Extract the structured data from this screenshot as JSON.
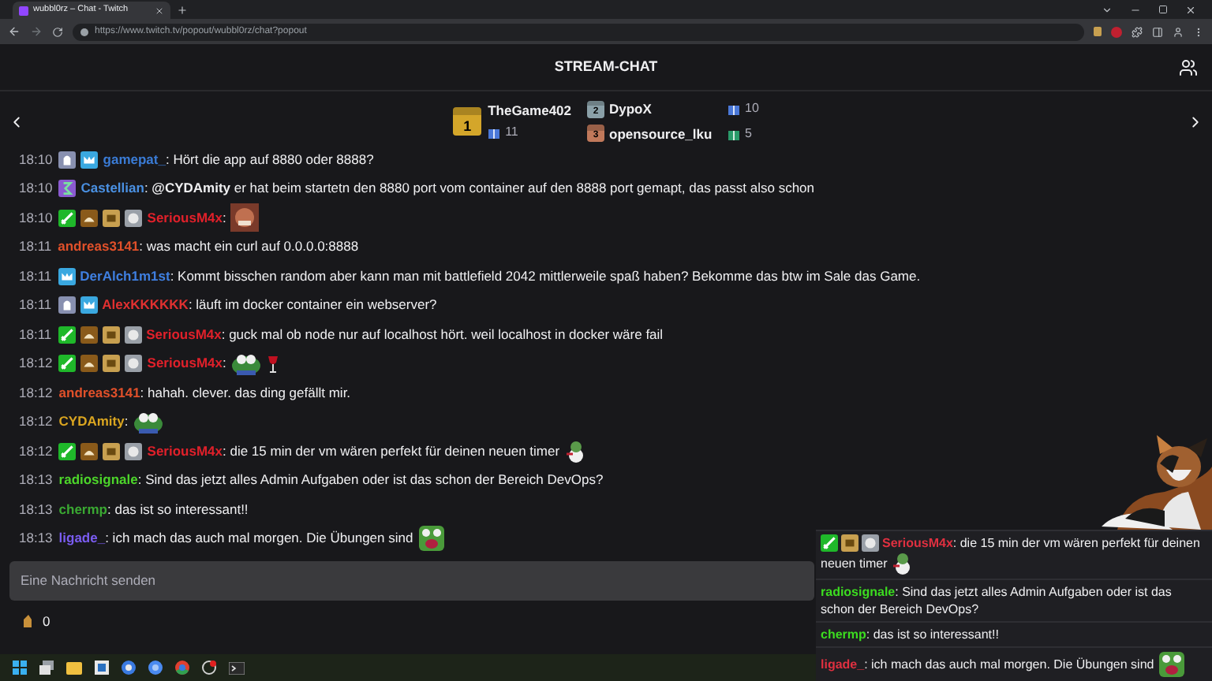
{
  "browser": {
    "tab_title": "wubbl0rz – Chat - Twitch",
    "url": "https://www.twitch.tv/popout/wubbl0rz/chat?popout"
  },
  "chat": {
    "title": "STREAM-CHAT"
  },
  "leaderboard": [
    {
      "rank": "1",
      "name": "TheGame402",
      "count": "11"
    },
    {
      "rank": "2",
      "name": "DypoX",
      "count": "10"
    },
    {
      "rank": "3",
      "name": "opensource_lku",
      "count": "5"
    }
  ],
  "messages": [
    {
      "time": "18:10",
      "badges": [
        {
          "kind": "ghost"
        },
        {
          "kind": "crown"
        }
      ],
      "user": "gamepat_",
      "color": "#3a7bd5",
      "text": ": Hört die app auf 8880 oder 8888?"
    },
    {
      "time": "18:10",
      "badges": [
        {
          "kind": "glyph"
        }
      ],
      "user": "Castellian",
      "color": "#4a90e2",
      "text": ": **@CYDAmity** er hat beim startetn den 8880 port vom container auf den 8888 port gemapt, das passt also schon"
    },
    {
      "time": "18:10",
      "badges": [
        {
          "kind": "sword"
        },
        {
          "kind": "hand"
        },
        {
          "kind": "box"
        },
        {
          "kind": "disc"
        }
      ],
      "user": "SeriousM4x",
      "color": "#e0202a",
      "text": ":",
      "emotes": [
        {
          "kind": "face"
        }
      ]
    },
    {
      "time": "18:11",
      "user": "andreas3141",
      "color": "#e0502a",
      "text": ": was macht ein curl auf 0.0.0.0:8888"
    },
    {
      "time": "18:11",
      "badges": [
        {
          "kind": "crown"
        }
      ],
      "user": "DerAlch1m1st",
      "color": "#3f7fe0",
      "text": ": Kommt bisschen random aber kann man mit battlefield 2042 mittlerweile spaß haben? Bekomme das btw im Sale das Game."
    },
    {
      "time": "18:11",
      "badges": [
        {
          "kind": "ghost"
        },
        {
          "kind": "crown"
        }
      ],
      "user": "AlexKKKKKK",
      "color": "#e03030",
      "text": ": läuft im docker container ein webserver?"
    },
    {
      "time": "18:11",
      "badges": [
        {
          "kind": "sword"
        },
        {
          "kind": "hand"
        },
        {
          "kind": "box"
        },
        {
          "kind": "disc"
        }
      ],
      "user": "SeriousM4x",
      "color": "#e0202a",
      "text": ": guck mal ob node nur auf localhost hört. weil localhost in docker wäre fail"
    },
    {
      "time": "18:12",
      "badges": [
        {
          "kind": "sword"
        },
        {
          "kind": "hand"
        },
        {
          "kind": "box"
        },
        {
          "kind": "disc"
        }
      ],
      "user": "SeriousM4x",
      "color": "#e0202a",
      "text": ":",
      "emotes": [
        {
          "kind": "frog"
        },
        {
          "kind": "glass"
        }
      ]
    },
    {
      "time": "18:12",
      "user": "andreas3141",
      "color": "#e0502a",
      "text": ": hahah. clever. das ding gefällt mir."
    },
    {
      "time": "18:12",
      "user": "CYDAmity",
      "color": "#daa520",
      "text": ":",
      "emotes": [
        {
          "kind": "frog"
        }
      ]
    },
    {
      "time": "18:12",
      "badges": [
        {
          "kind": "sword"
        },
        {
          "kind": "hand"
        },
        {
          "kind": "box"
        },
        {
          "kind": "disc"
        }
      ],
      "user": "SeriousM4x",
      "color": "#e0202a",
      "text": ": die 15 min der vm wären perfekt für deinen neuen timer",
      "emotes": [
        {
          "kind": "snowman"
        }
      ]
    },
    {
      "time": "18:13",
      "user": "radiosignale",
      "color": "#4cd42a",
      "text": ": Sind das jetzt alles Admin Aufgaben oder ist das schon der Bereich DevOps?"
    },
    {
      "time": "18:13",
      "user": "chermp",
      "color": "#3aa832",
      "text": ": das ist so interessant!!"
    },
    {
      "time": "18:13",
      "user": "ligade_",
      "color": "#7a5cf0",
      "text": ": ich mach das auch mal morgen. Die Übungen sind",
      "emotes": [
        {
          "kind": "shout"
        }
      ]
    }
  ],
  "input": {
    "placeholder": "Eine Nachricht senden"
  },
  "points": "0",
  "overlay": [
    {
      "badges": [
        {
          "kind": "sword"
        },
        {
          "kind": "box"
        },
        {
          "kind": "disc"
        }
      ],
      "user": "SeriousM4x",
      "color": "#e03040",
      "text": ": die 15 min der vm wären perfekt für deinen neuen timer",
      "emotes": [
        {
          "kind": "snowman"
        }
      ]
    },
    {
      "user": "radiosignale",
      "color": "#3cdc20",
      "text": ": Sind das jetzt alles Admin Aufgaben oder ist das schon der Bereich DevOps?"
    },
    {
      "user": "chermp",
      "color": "#3cdc20",
      "text": ": das ist so interessant!!"
    },
    {
      "user": "ligade_",
      "color": "#e03040",
      "text": ": ich mach das auch mal morgen. Die Übungen sind",
      "emotes": [
        {
          "kind": "shout"
        }
      ]
    }
  ]
}
